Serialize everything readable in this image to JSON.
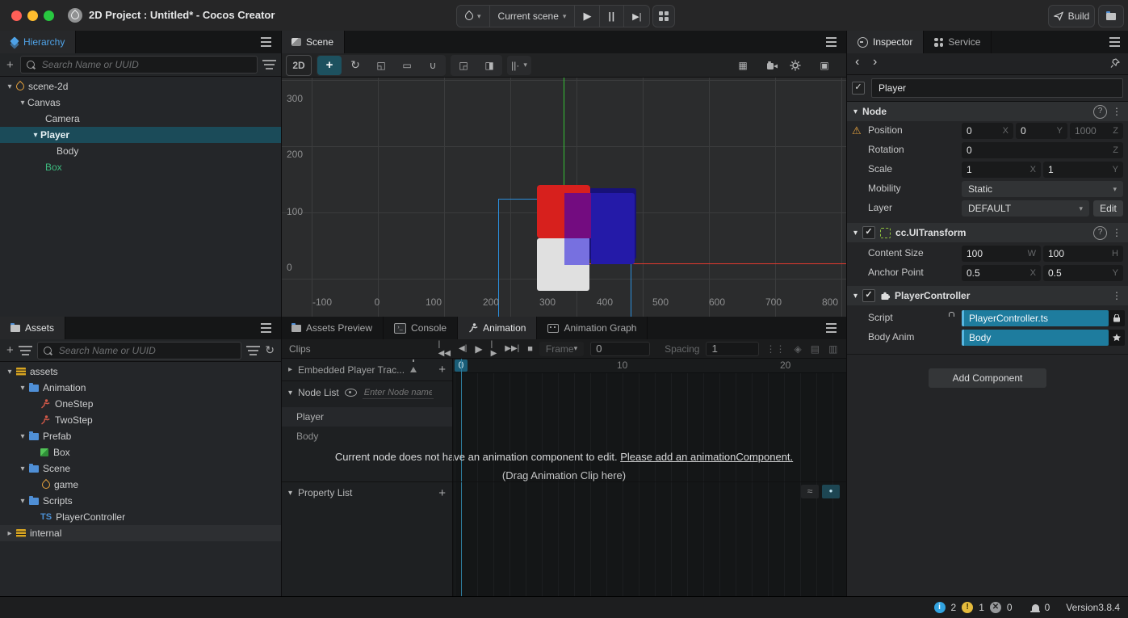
{
  "window": {
    "title": "2D Project : Untitled* - Cocos Creator"
  },
  "toolbar": {
    "scene_select_label": "Current scene",
    "build_label": "Build"
  },
  "hierarchy": {
    "tab": "Hierarchy",
    "search_placeholder": "Search Name or UUID",
    "nodes": [
      {
        "label": "scene-2d"
      },
      {
        "label": "Canvas"
      },
      {
        "label": "Camera"
      },
      {
        "label": "Player"
      },
      {
        "label": "Body"
      },
      {
        "label": "Box"
      }
    ]
  },
  "assets": {
    "tab": "Assets",
    "search_placeholder": "Search Name or UUID",
    "items": [
      {
        "label": "assets"
      },
      {
        "label": "Animation"
      },
      {
        "label": "OneStep"
      },
      {
        "label": "TwoStep"
      },
      {
        "label": "Prefab"
      },
      {
        "label": "Box"
      },
      {
        "label": "Scene"
      },
      {
        "label": "game"
      },
      {
        "label": "Scripts"
      },
      {
        "label": "PlayerController"
      },
      {
        "label": "internal"
      }
    ]
  },
  "scene": {
    "tab": "Scene",
    "mode": "2D",
    "x_ticks": [
      "-100",
      "0",
      "100",
      "200",
      "300",
      "400",
      "500",
      "600",
      "700",
      "800"
    ],
    "y_ticks": [
      "300",
      "200",
      "100",
      "0"
    ]
  },
  "bottom": {
    "tabs": [
      "Assets Preview",
      "Console",
      "Animation",
      "Animation Graph"
    ],
    "clips_label": "Clips",
    "frame_label": "Frame",
    "frame_value": "0",
    "spacing_label": "Spacing",
    "spacing_value": "1",
    "ruler": [
      "0",
      "10",
      "20"
    ],
    "embedded_track": "Embedded Player Trac...",
    "node_list_label": "Node List",
    "node_search_placeholder": "Enter Node name",
    "node_rows": [
      "Player",
      "Body"
    ],
    "empty_message": "Current node does not have an animation component to edit.",
    "empty_message_link": "Please add an animationComponent.",
    "drop_hint": "(Drag Animation Clip here)",
    "property_list_label": "Property List"
  },
  "inspector": {
    "tabs": [
      "Inspector",
      "Service"
    ],
    "node_name": "Player",
    "axes": {
      "x": "X",
      "y": "Y",
      "z": "Z",
      "w": "W",
      "h": "H"
    },
    "node_section": {
      "title": "Node",
      "position_label": "Position",
      "position": {
        "x": "0",
        "y": "0",
        "z": "1000"
      },
      "rotation_label": "Rotation",
      "rotation_z": "0",
      "scale_label": "Scale",
      "scale": {
        "x": "1",
        "y": "1"
      },
      "mobility_label": "Mobility",
      "mobility_value": "Static",
      "layer_label": "Layer",
      "layer_value": "DEFAULT",
      "edit_label": "Edit"
    },
    "uitransform_section": {
      "title": "cc.UITransform",
      "content_size_label": "Content Size",
      "content_size": {
        "w": "100",
        "h": "100"
      },
      "anchor_label": "Anchor Point",
      "anchor": {
        "x": "0.5",
        "y": "0.5"
      }
    },
    "controller_section": {
      "title": "PlayerController",
      "script_label": "Script",
      "script_value": "PlayerController.ts",
      "body_label": "Body Anim",
      "body_value": "Body"
    },
    "add_component_label": "Add Component"
  },
  "statusbar": {
    "info_count": "2",
    "warning_count": "1",
    "error_count": "0",
    "bell_count": "0",
    "version": "Version3.8.4"
  },
  "colors": {
    "selection": "#1b4b59",
    "accent_teal": "#1e7c9e",
    "red_box": "#d7201d",
    "blue_box": "#241aa8",
    "purple_overlap": "#730c80",
    "light_blue_overlap": "#7770e0",
    "white_box": "#e0e0e0",
    "axis_green": "#35c135",
    "axis_red": "#e23a2e",
    "outline_blue": "#2b8fdd"
  },
  "icons": {
    "check": "✓",
    "chevron_down": "▾",
    "chevron_right": "▸",
    "more_vertical": "⋮",
    "help": "?",
    "back": "‹",
    "forward": "›",
    "caret": "▾",
    "play": "▶",
    "pause": "||",
    "step_forward_small": "▶|",
    "to_start": "|◀◀",
    "step_back": "◀|",
    "tr_play": "▶",
    "tr_step": "|▶",
    "to_end": "▶▶|",
    "stop": "■",
    "plus": "+",
    "typescript": "TS",
    "rotate_tool": "↻",
    "scale_tool": "◱",
    "rect_tool": "▭",
    "union_tool": "∪",
    "snap_a": "◲",
    "snap_b": "◨",
    "slider_tool": "||·",
    "grid_toggle": "▦",
    "keyframe": "◈",
    "save": "▤",
    "card": "▥",
    "doc": "▣",
    "exit": "↦",
    "dots_grid": "⋮⋮",
    "curve": "≈",
    "dot": "●"
  }
}
